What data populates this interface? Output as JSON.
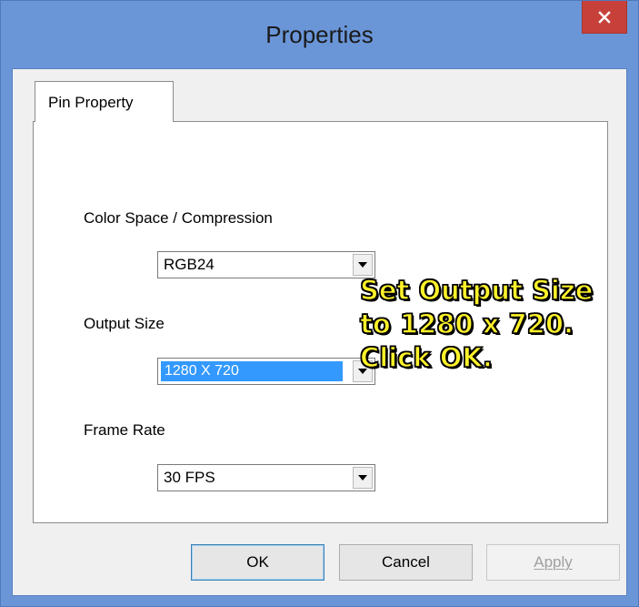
{
  "window": {
    "title": "Properties",
    "close_icon": "close-icon"
  },
  "tabs": [
    {
      "label": "Pin Property",
      "active": true
    }
  ],
  "fields": {
    "color_space": {
      "label": "Color Space / Compression",
      "value": "RGB24"
    },
    "output_size": {
      "label": "Output Size",
      "value": "1280 X 720",
      "highlighted": true
    },
    "frame_rate": {
      "label": "Frame Rate",
      "value": "30 FPS"
    }
  },
  "callout": {
    "lines": [
      "Set Output Size",
      "to 1280 x 720.",
      "Click OK."
    ],
    "color": "#fff22a"
  },
  "buttons": {
    "ok": "OK",
    "cancel": "Cancel",
    "apply": "Apply"
  },
  "colors": {
    "titlebar": "#6a96d8",
    "close_button": "#c7413a",
    "selection": "#3399ff"
  }
}
